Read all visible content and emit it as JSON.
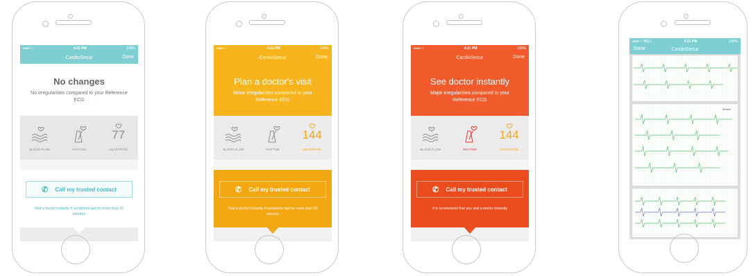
{
  "status": {
    "time": "4:21 PM",
    "battery": "100%",
    "signal": "●●●○○",
    "carrier": "●●●○○ BELL"
  },
  "app_title": "CardioSecur",
  "done_label": "Done",
  "metric_labels": {
    "blood_flow": "BLOOD FLOW",
    "rhythm": "RHYTHM",
    "heartrate": "HEARTRATE"
  },
  "call_label": "Call my trusted contact",
  "screens": [
    {
      "title": "No changes",
      "subtitle": "No irregularities compared to your Reference ECG",
      "heartrate": "77",
      "advice": "Visit a doctor instantly if symptoms last for more than 20 minutes",
      "accent": "#7dcfd1"
    },
    {
      "title": "Plan a doctor's visit",
      "subtitle": "Minor irregularities compared to your Reference ECG",
      "heartrate": "144",
      "advice": "Visit a doctor instantly if symptoms last for more than 20 minutes",
      "accent": "#f7b41c"
    },
    {
      "title": "See doctor instantly",
      "subtitle": "Major irregularities compared to your Reference ECG",
      "heartrate": "144",
      "advice": "It is recommend that you visit a doctor instantly",
      "accent": "#f15b2c"
    }
  ],
  "ecg_screen": {
    "hr_label": "84/min"
  },
  "icons": {
    "blood_flow": "wave-heart-icon",
    "rhythm": "metronome-heart-icon",
    "heartrate": "heart-icon",
    "call": "phone-icon"
  }
}
